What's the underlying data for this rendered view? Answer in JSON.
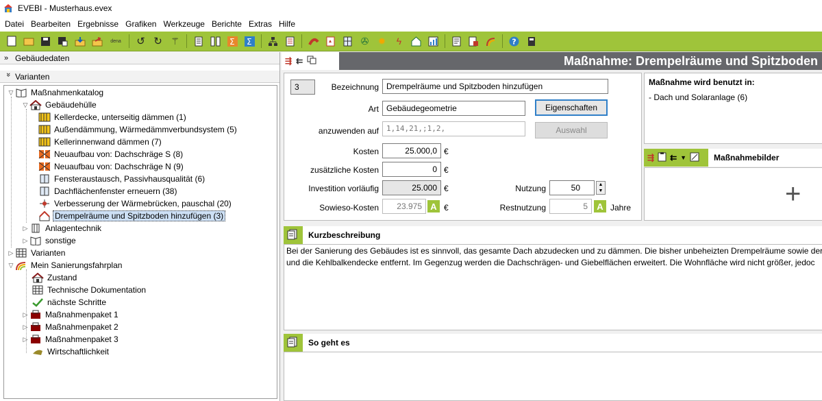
{
  "window": {
    "title": "EVEBI - Musterhaus.evex"
  },
  "menu": [
    "Datei",
    "Bearbeiten",
    "Ergebnisse",
    "Grafiken",
    "Werkzeuge",
    "Berichte",
    "Extras",
    "Hilfe"
  ],
  "toolbar": {
    "dena_label": "dena"
  },
  "left": {
    "headers": {
      "gebaeudedaten": "Gebäudedaten",
      "varianten": "Varianten"
    },
    "tree": {
      "katalog": "Maßnahmenkatalog",
      "huelle": "Gebäudehülle",
      "items": [
        "Kellerdecke, unterseitig dämmen (1)",
        "Außendämmung, Wärmedämmverbundsystem (5)",
        "Kellerinnenwand dämmen (7)",
        "Neuaufbau von: Dachschräge S (8)",
        "Neuaufbau von: Dachschräge N (9)",
        "Fensteraustausch, Passivhausqualität (6)",
        "Dachflächenfenster erneuern (38)",
        "Verbesserung der Wärmebrücken, pauschal (20)",
        "Drempelräume und Spitzboden hinzufügen (3)"
      ],
      "anlagentechnik": "Anlagentechnik",
      "sonstige": "sonstige",
      "varianten": "Varianten",
      "fahrplan": "Mein Sanierungsfahrplan",
      "fahrplan_items": [
        "Zustand",
        "Technische Dokumentation",
        "nächste Schritte",
        "Maßnahmenpaket 1",
        "Maßnahmenpaket 2",
        "Maßnahmenpaket 3",
        "Wirtschaftlichkeit"
      ]
    }
  },
  "header": {
    "title": "Maßnahme: Drempelräume und Spitzboden"
  },
  "form": {
    "id": "3",
    "bezeichnung_label": "Bezeichnung",
    "bezeichnung": "Drempelräume und Spitzboden hinzufügen",
    "art_label": "Art",
    "art": "Gebäudegeometrie",
    "eigenschaften": "Eigenschaften",
    "anzuwenden_label": "anzuwenden auf",
    "anzuwenden": "1,14,21,;1,2,",
    "auswahl": "Auswahl",
    "kosten_label": "Kosten",
    "kosten": "25.000,0",
    "zus_label": "zusätzliche Kosten",
    "zus": "0",
    "invest_label": "Investition vorläufig",
    "invest": "25.000",
    "sowieso_label": "Sowieso-Kosten",
    "sowieso": "23.975",
    "nutzung_label": "Nutzung",
    "nutzung": "50",
    "rest_label": "Restnutzung",
    "rest": "5",
    "jahre": "Jahre",
    "euro": "€",
    "badge": "A"
  },
  "usedin": {
    "title": "Maßnahme wird benutzt in:",
    "items": [
      "- Dach und Solaranlage (6)"
    ]
  },
  "images": {
    "title": "Maßnahmebilder",
    "plus": "+"
  },
  "kurz": {
    "title": "Kurzbeschreibung",
    "line1": "Bei der Sanierung des Gebäudes ist es sinnvoll, das gesamte Dach abzudecken und zu dämmen. Die bisher unbeheizten Drempelräume sowie der S",
    "line2": "und die Kehlbalkendecke entfernt. Im Gegenzug werden die Dachschrägen- und Giebelflächen erweitert. Die Wohnfläche wird nicht größer, jedoc"
  },
  "how": {
    "title": "So geht es"
  },
  "colors": {
    "accent": "#9fc43a",
    "title_bar": "#66676b"
  }
}
